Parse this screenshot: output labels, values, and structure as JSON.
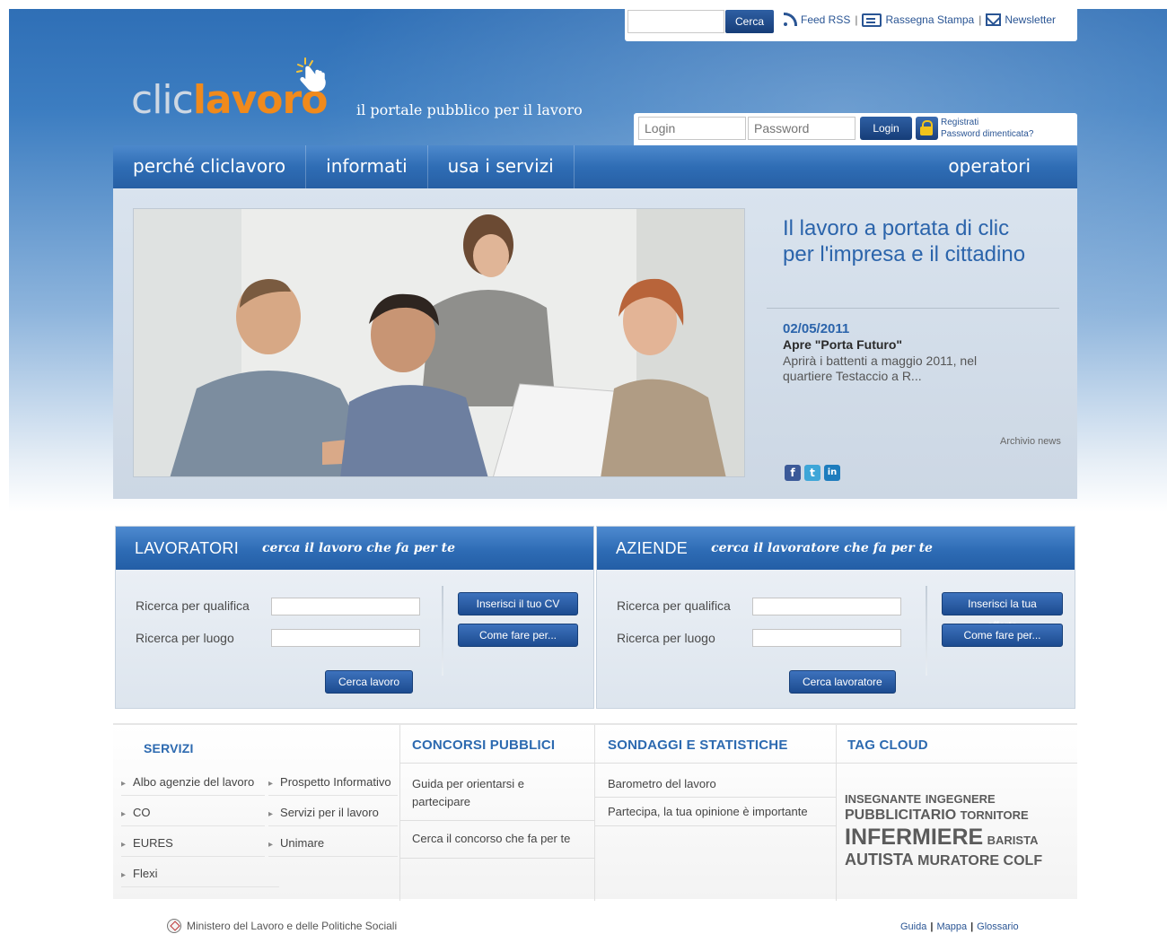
{
  "util": {
    "search_button": "Cerca",
    "feed": "Feed RSS",
    "press": "Rassegna Stampa",
    "newsletter": "Newsletter",
    "separator": "|"
  },
  "logo": {
    "part1": "clic",
    "part2": "lavoro",
    "tagline": "il portale pubblico per il lavoro"
  },
  "login": {
    "user_placeholder": "Login",
    "pass_placeholder": "Password",
    "button": "Login",
    "register": "Registrati",
    "forgot": "Password dimenticata?"
  },
  "nav": {
    "items": [
      "perché cliclavoro",
      "informati",
      "usa i servizi"
    ],
    "right": "operatori"
  },
  "hero": {
    "title_line1": "Il lavoro a portata di clic",
    "title_line2": "per l'impresa e il cittadino",
    "news_date": "02/05/2011",
    "news_title": "Apre \"Porta Futuro\"",
    "news_body": "Aprirà i battenti a maggio 2011, nel quartiere Testaccio a R...",
    "archive": "Archivio news",
    "social": [
      "f",
      "t",
      "in"
    ]
  },
  "lavoratori": {
    "title": "LAVORATORI",
    "subtitle": "cerca il lavoro che fa per te",
    "label_qualifica": "Ricerca per qualifica",
    "label_luogo": "Ricerca per luogo",
    "btn_cv": "Inserisci il tuo CV",
    "btn_come": "Come fare per...",
    "btn_cerca": "Cerca lavoro"
  },
  "aziende": {
    "title": "AZIENDE",
    "subtitle": "cerca il lavoratore che fa per te",
    "label_qualifica": "Ricerca per qualifica",
    "label_luogo": "Ricerca per luogo",
    "btn_offerta": "Inserisci la tua offerta",
    "btn_come": "Come fare per...",
    "btn_cerca": "Cerca lavoratore"
  },
  "servizi": {
    "title": "SERVIZI",
    "left": [
      "Albo agenzie del lavoro",
      "CO",
      "EURES",
      "Flexi"
    ],
    "right": [
      "Prospetto Informativo",
      "Servizi per il lavoro",
      "Unimare"
    ]
  },
  "concorsi": {
    "title": "CONCORSI PUBBLICI",
    "items": [
      "Guida per orientarsi e partecipare",
      "Cerca il concorso che fa per te"
    ]
  },
  "sondaggi": {
    "title": "SONDAGGI E STATISTICHE",
    "items": [
      "Barometro del lavoro",
      "Partecipa, la tua opinione è importante"
    ]
  },
  "tags": {
    "title": "TAG CLOUD",
    "t1": "INSEGNANTE",
    "t2": "INGEGNERE",
    "t3": "PUBBLICITARIO",
    "t4": "TORNITORE",
    "t5": "INFERMIERE",
    "t6": "BARISTA",
    "t7": "AUTISTA",
    "t8": "MURATORE",
    "t9": "COLF"
  },
  "footer": {
    "ministry": "Ministero del Lavoro e delle Politiche Sociali",
    "links": [
      "Guida",
      "Mappa",
      "Glossario"
    ]
  },
  "colors": {
    "brand_blue": "#2f6db5",
    "link_blue": "#2a5594",
    "logo_orange": "#f08a1c"
  }
}
